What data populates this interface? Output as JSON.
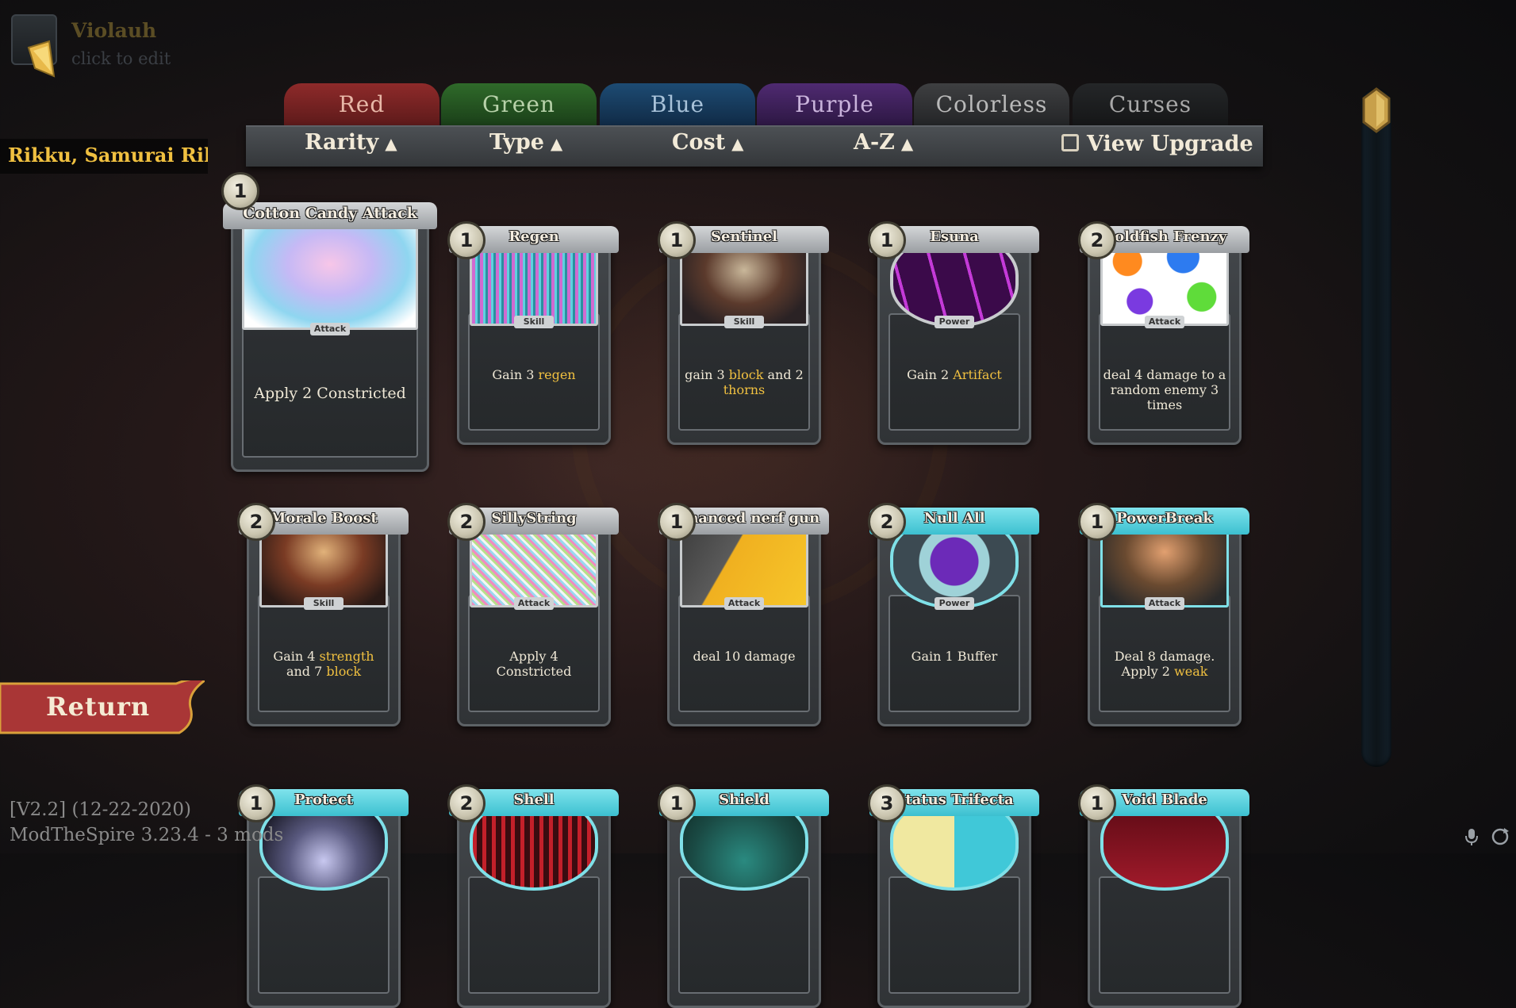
{
  "profile": {
    "name": "Violauh",
    "edit_hint": "click to edit"
  },
  "characters": {
    "list_text": "Rikku, Samurai Rikku, P"
  },
  "tabs": [
    {
      "label": "Red"
    },
    {
      "label": "Green"
    },
    {
      "label": "Blue"
    },
    {
      "label": "Purple"
    },
    {
      "label": "Colorless"
    },
    {
      "label": "Curses"
    }
  ],
  "sort": {
    "rarity": "Rarity",
    "type": "Type",
    "cost": "Cost",
    "az": "A-Z",
    "arrow": "▲",
    "view_upgrade": "View Upgrade"
  },
  "return_label": "Return",
  "version": "[V2.2] (12-22-2020)",
  "mod_info": "ModTheSpire 3.23.4 - 3 mods",
  "cards": [
    {
      "cost": "1",
      "title": "Cotton Candy Attack",
      "type": "Attack",
      "desc": [
        "Apply 2 Constricted"
      ]
    },
    {
      "cost": "1",
      "title": "Regen",
      "type": "Skill",
      "desc": [
        "Gain 3 ",
        "regen",
        ""
      ]
    },
    {
      "cost": "1",
      "title": "Sentinel",
      "type": "Skill",
      "desc": [
        "gain 3 ",
        "block",
        " and 2 ",
        "thorns"
      ]
    },
    {
      "cost": "1",
      "title": "Esuna",
      "type": "Power",
      "desc": [
        "Gain 2 ",
        "Artifact"
      ]
    },
    {
      "cost": "2",
      "title": "Goldfish Frenzy",
      "type": "Attack",
      "desc": [
        "deal 4 damage to a random enemy 3 times"
      ]
    },
    {
      "cost": "2",
      "title": "Morale Boost",
      "type": "Skill",
      "desc": [
        "Gain 4 ",
        "strength",
        " and 7 ",
        "block"
      ]
    },
    {
      "cost": "2",
      "title": "SillyString",
      "type": "Attack",
      "desc": [
        "Apply 4 Constricted"
      ]
    },
    {
      "cost": "1",
      "title": "enhanced nerf gun",
      "type": "Attack",
      "desc": [
        "deal 10 damage"
      ]
    },
    {
      "cost": "2",
      "title": "Null All",
      "type": "Power",
      "desc": [
        "Gain 1 Buffer"
      ]
    },
    {
      "cost": "1",
      "title": "PowerBreak",
      "type": "Attack",
      "desc": [
        "Deal 8 damage. Apply 2 ",
        "weak"
      ]
    },
    {
      "cost": "1",
      "title": "Protect"
    },
    {
      "cost": "2",
      "title": "Shell"
    },
    {
      "cost": "1",
      "title": "Shield"
    },
    {
      "cost": "3",
      "title": "Status Trifecta"
    },
    {
      "cost": "1",
      "title": "Void Blade"
    }
  ]
}
